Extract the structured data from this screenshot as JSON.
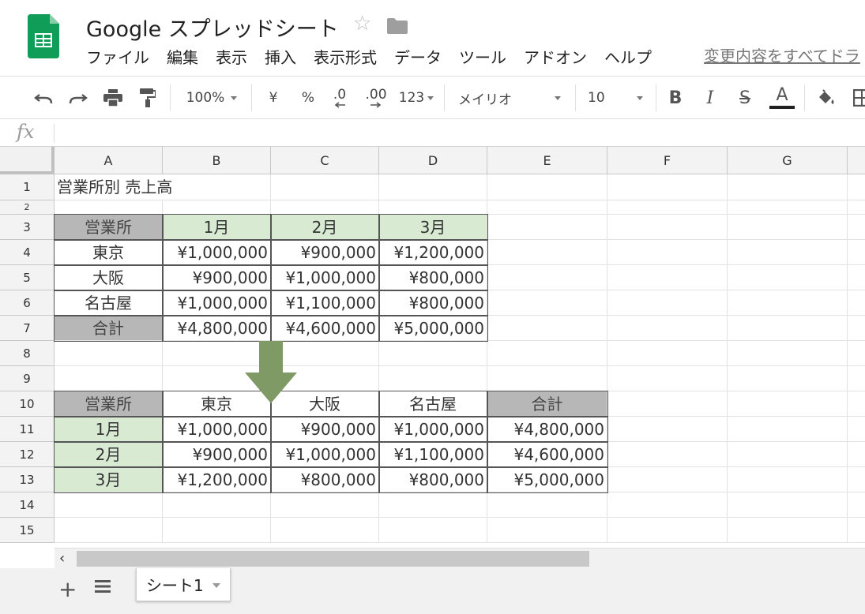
{
  "app": {
    "title": "Google スプレッドシート",
    "menus": [
      "ファイル",
      "編集",
      "表示",
      "挿入",
      "表示形式",
      "データ",
      "ツール",
      "アドオン",
      "ヘルプ"
    ],
    "save_status": "変更内容をすべてドラ"
  },
  "toolbar": {
    "zoom": "100%",
    "currency": "¥",
    "percent": "%",
    "decrease_decimal": ".0",
    "increase_decimal": ".00",
    "more_formats": "123",
    "font": "メイリオ",
    "font_size": "10",
    "bold": "B",
    "italic": "I",
    "strike": "S",
    "text_color": "A",
    "text_color_value": "#222222"
  },
  "formula_bar": {
    "fx": "fx",
    "value": ""
  },
  "columns": [
    "A",
    "B",
    "C",
    "D",
    "E",
    "F",
    "G"
  ],
  "rows": [
    "1",
    "2",
    "3",
    "4",
    "5",
    "6",
    "7",
    "8",
    "9",
    "10",
    "11",
    "12",
    "13",
    "14",
    "15"
  ],
  "sheet": {
    "title": "営業所別 売上高",
    "table1": {
      "header": [
        "営業所",
        "1月",
        "2月",
        "3月"
      ],
      "rows": [
        [
          "東京",
          "¥1,000,000",
          "¥900,000",
          "¥1,200,000"
        ],
        [
          "大阪",
          "¥900,000",
          "¥1,000,000",
          "¥800,000"
        ],
        [
          "名古屋",
          "¥1,000,000",
          "¥1,100,000",
          "¥800,000"
        ],
        [
          "合計",
          "¥4,800,000",
          "¥4,600,000",
          "¥5,000,000"
        ]
      ]
    },
    "table2": {
      "header": [
        "営業所",
        "東京",
        "大阪",
        "名古屋",
        "合計"
      ],
      "rows": [
        [
          "1月",
          "¥1,000,000",
          "¥900,000",
          "¥1,000,000",
          "¥4,800,000"
        ],
        [
          "2月",
          "¥900,000",
          "¥1,000,000",
          "¥1,100,000",
          "¥4,600,000"
        ],
        [
          "3月",
          "¥1,200,000",
          "¥800,000",
          "¥800,000",
          "¥5,000,000"
        ]
      ]
    }
  },
  "colors": {
    "header_gray": "#b7b7b7",
    "month_green": "#d9ead3",
    "arrow_green": "#7f9a65",
    "logo_green": "#0f9d58"
  },
  "sheet_tabs": {
    "active": "シート1"
  }
}
